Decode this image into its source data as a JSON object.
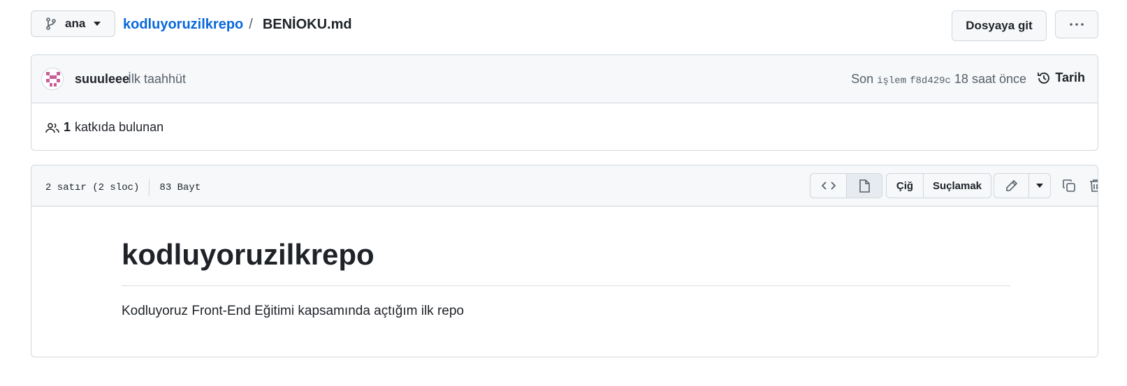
{
  "header": {
    "branch_name": "ana",
    "repo_name": "kodluyoruzilkrepo",
    "separator": "/",
    "file_name": "BENİOKU.md",
    "goto_file_label": "Dosyaya git"
  },
  "commit": {
    "author": "suuuleee",
    "message": "İlk taahhüt",
    "last_commit_label": "Son",
    "last_commit_word": "işlem",
    "hash": "f8d429c",
    "time_ago": "18 saat önce",
    "history_label": "Tarih",
    "contributors_count": "1",
    "contributors_label": "katkıda bulunan"
  },
  "file": {
    "lines_info": "2 satır (2 sloc)",
    "size_info": "83 Bayt",
    "raw_label": "Çiğ",
    "blame_label": "Suçlamak"
  },
  "content": {
    "title": "kodluyoruzilkrepo",
    "paragraph": "Kodluyoruz Front-End Eğitimi kapsamında açtığım ilk repo"
  },
  "colors": {
    "link": "#0969da",
    "border": "#d0d7de",
    "header_bg": "#f6f8fa",
    "avatar_accent": "#c95e9a"
  }
}
